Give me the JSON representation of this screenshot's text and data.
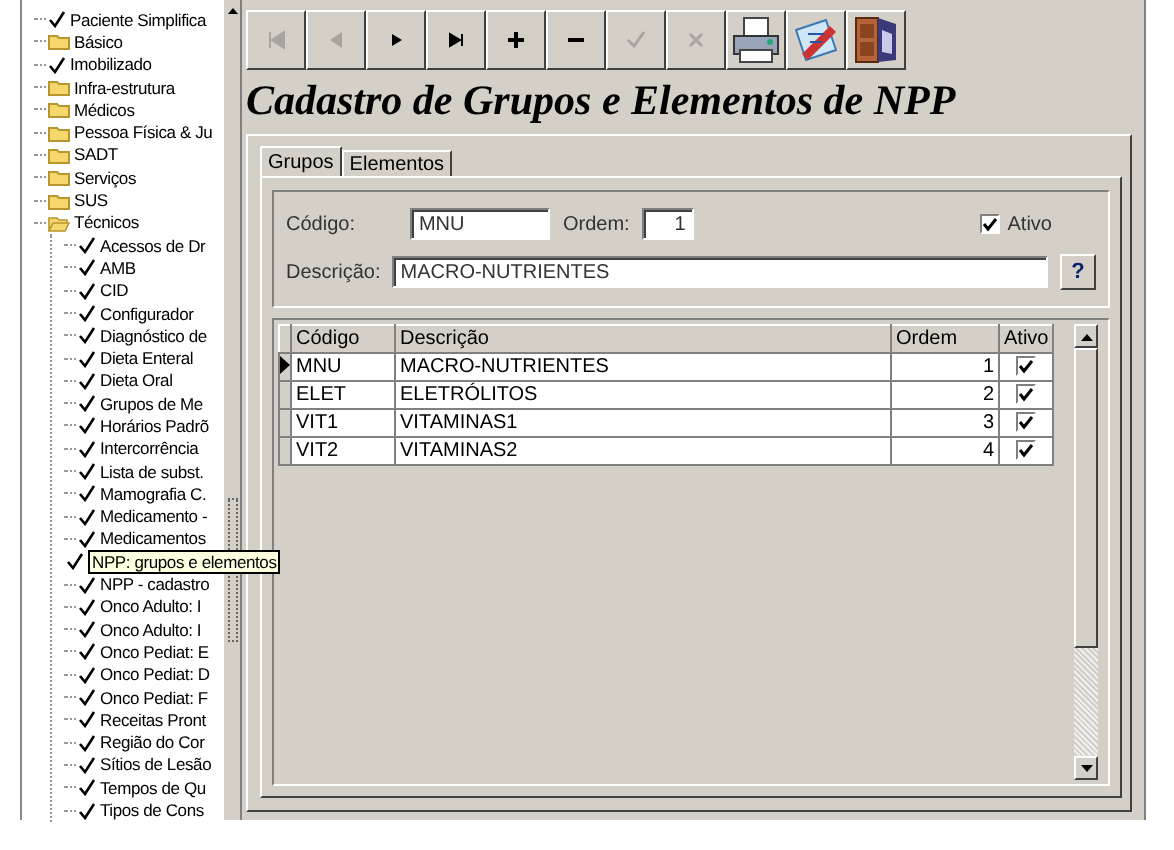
{
  "tree": [
    {
      "label": "Paciente Simplifica",
      "kind": "check"
    },
    {
      "label": "Básico",
      "kind": "folder",
      "expanded": false
    },
    {
      "label": "Imobilizado",
      "kind": "check"
    },
    {
      "label": "Infra-estrutura",
      "kind": "folder",
      "expanded": false
    },
    {
      "label": "Médicos",
      "kind": "folder",
      "expanded": false
    },
    {
      "label": "Pessoa Física & Ju",
      "kind": "folder",
      "expanded": false
    },
    {
      "label": "SADT",
      "kind": "folder",
      "expanded": false
    },
    {
      "label": "Serviços",
      "kind": "folder",
      "expanded": false
    },
    {
      "label": "SUS",
      "kind": "folder",
      "expanded": false
    },
    {
      "label": "Técnicos",
      "kind": "folder",
      "expanded": true,
      "children": [
        {
          "label": "Acessos de Dr",
          "kind": "check"
        },
        {
          "label": "AMB",
          "kind": "check"
        },
        {
          "label": "CID",
          "kind": "check"
        },
        {
          "label": "Configurador",
          "kind": "check"
        },
        {
          "label": "Diagnóstico de",
          "kind": "check"
        },
        {
          "label": "Dieta Enteral",
          "kind": "check"
        },
        {
          "label": "Dieta Oral",
          "kind": "check"
        },
        {
          "label": "Grupos de Me",
          "kind": "check"
        },
        {
          "label": "Horários Padrõ",
          "kind": "check"
        },
        {
          "label": "Intercorrência",
          "kind": "check"
        },
        {
          "label": "Lista de subst.",
          "kind": "check"
        },
        {
          "label": "Mamografia C.",
          "kind": "check"
        },
        {
          "label": "Medicamento -",
          "kind": "check"
        },
        {
          "label": "Medicamentos",
          "kind": "check"
        },
        {
          "label": "NPP: grupos e elementos",
          "kind": "check",
          "tooltip": true
        },
        {
          "label": "NPP - cadastro",
          "kind": "check"
        },
        {
          "label": "Onco Adulto: I",
          "kind": "check"
        },
        {
          "label": "Onco Adulto: I",
          "kind": "check"
        },
        {
          "label": "Onco Pediat: E",
          "kind": "check"
        },
        {
          "label": "Onco Pediat: D",
          "kind": "check"
        },
        {
          "label": "Onco Pediat: F",
          "kind": "check"
        },
        {
          "label": "Receitas Pront",
          "kind": "check"
        },
        {
          "label": "Região do Cor",
          "kind": "check"
        },
        {
          "label": "Sítios de Lesão",
          "kind": "check"
        },
        {
          "label": "Tempos de Qu",
          "kind": "check"
        },
        {
          "label": "Tipos de Cons",
          "kind": "check"
        }
      ]
    }
  ],
  "toolbar": [
    {
      "kind": "first",
      "disabled": true
    },
    {
      "kind": "prior",
      "disabled": true
    },
    {
      "kind": "next",
      "disabled": false
    },
    {
      "kind": "last",
      "disabled": false
    },
    {
      "kind": "insert",
      "disabled": false
    },
    {
      "kind": "delete",
      "disabled": false
    },
    {
      "kind": "post",
      "disabled": true
    },
    {
      "kind": "cancel",
      "disabled": true
    },
    {
      "kind": "print",
      "disabled": false
    },
    {
      "kind": "edit",
      "disabled": false
    },
    {
      "kind": "exit",
      "disabled": false
    }
  ],
  "title": "Cadastro de Grupos e Elementos de NPP",
  "tabs": [
    {
      "label": "Grupos",
      "selected": true
    },
    {
      "label": "Elementos",
      "selected": false
    }
  ],
  "form": {
    "codigo_label": "Código:",
    "codigo": "MNU",
    "ordem_label": "Ordem:",
    "ordem": "1",
    "ativo_label": "Ativo",
    "ativo": true,
    "descricao_label": "Descrição:",
    "descricao": "MACRO-NUTRIENTES",
    "help_button": "?"
  },
  "table": {
    "columns": [
      "Código",
      "Descrição",
      "Ordem",
      "Ativo"
    ],
    "rows": [
      {
        "codigo": "MNU",
        "descricao": "MACRO-NUTRIENTES",
        "ordem": "1",
        "ativo": true,
        "selected": true
      },
      {
        "codigo": "ELET",
        "descricao": "ELETRÓLITOS",
        "ordem": "2",
        "ativo": true,
        "selected": false
      },
      {
        "codigo": "VIT1",
        "descricao": "VITAMINAS1",
        "ordem": "3",
        "ativo": true,
        "selected": false
      },
      {
        "codigo": "VIT2",
        "descricao": "VITAMINAS2",
        "ordem": "4",
        "ativo": true,
        "selected": false
      }
    ]
  }
}
